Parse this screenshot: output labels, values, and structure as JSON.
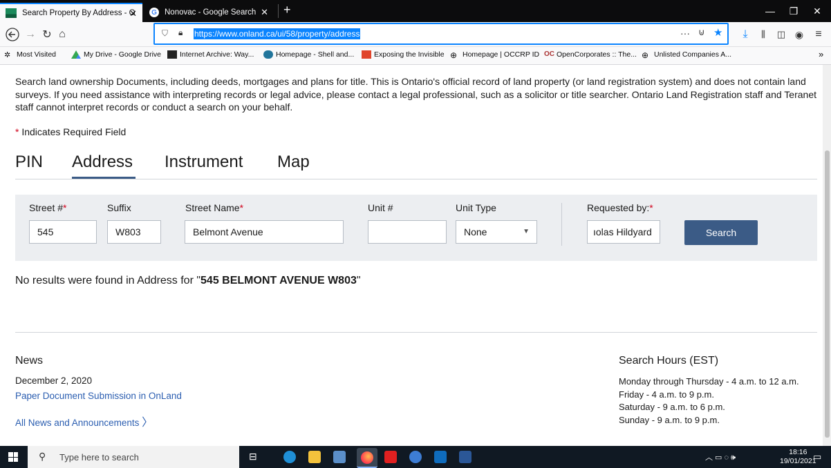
{
  "browser": {
    "tabs": [
      {
        "title": "Search Property By Address - O",
        "active": true
      },
      {
        "title": "Nonovac - Google Search",
        "active": false
      }
    ],
    "url": "https://www.onland.ca/ui/58/property/address",
    "bookmarks": [
      "Most Visited",
      "My Drive - Google Drive",
      "Internet Archive: Way...",
      "Homepage - Shell and...",
      "Exposing the Invisible",
      "Homepage | OCCRP ID",
      "OpenCorporates :: The...",
      "Unlisted Companies A..."
    ],
    "bookmarks_overflow": "»"
  },
  "page": {
    "intro": "Search land ownership Documents, including deeds, mortgages and plans for title. This is Ontario's official record of land property (or land registration system) and does not contain land surveys. If you need assistance with interpreting records or legal advice, please contact a legal professional, such as a solicitor or title searcher. Ontario Land Registration staff and Teranet staff cannot interpret records or conduct a search on your behalf.",
    "required_star": "*",
    "required_note": " Indicates Required Field",
    "tabs": [
      "PIN",
      "Address",
      "Instrument",
      "Map"
    ],
    "active_tab": "Address",
    "form": {
      "street_no_label": "Street #",
      "street_no_value": "545",
      "suffix_label": "Suffix",
      "suffix_value": "W803",
      "street_name_label": "Street Name",
      "street_name_value": "Belmont Avenue",
      "unit_label": "Unit #",
      "unit_value": "",
      "unit_type_label": "Unit Type",
      "unit_type_value": "None",
      "requested_by_label": "Requested by:",
      "requested_by_value": "ıolas Hildyard",
      "search_label": "Search"
    },
    "no_results_prefix": "No results were found in Address for \"",
    "no_results_query": "545 BELMONT AVENUE W803",
    "no_results_suffix": "\"",
    "news": {
      "heading": "News",
      "date": "December 2, 2020",
      "link": "Paper Document Submission in OnLand",
      "all_link": "All News and Announcements"
    },
    "hours": {
      "heading": "Search Hours (EST)",
      "lines": [
        "Monday through Thursday - 4 a.m. to 12 a.m.",
        "Friday - 4 a.m. to 9 p.m.",
        "Saturday - 9 a.m. to 6 p.m.",
        "Sunday - 9 a.m. to 9 p.m."
      ]
    }
  },
  "taskbar": {
    "search_placeholder": "Type here to search",
    "time": "18:16",
    "date": "19/01/2021"
  }
}
